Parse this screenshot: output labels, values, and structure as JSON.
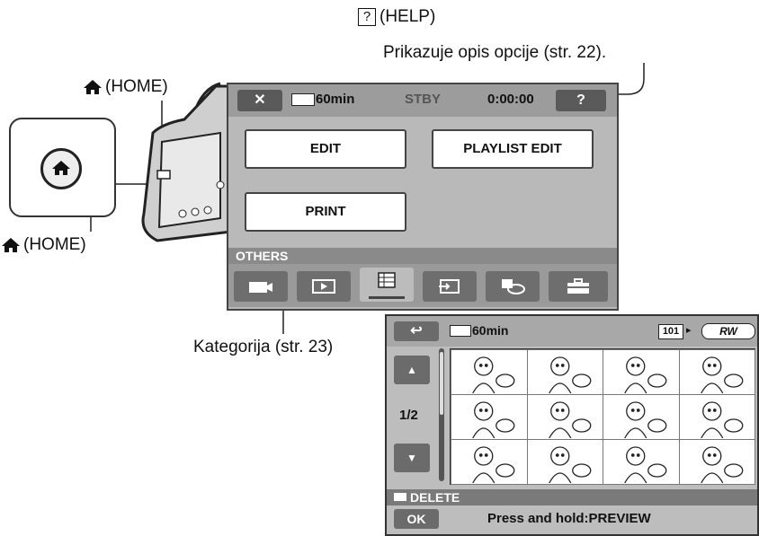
{
  "help_callout": {
    "box_glyph": "?",
    "label": "(HELP)",
    "description": "Prikazuje opis opcije (str. 22)."
  },
  "home_top_label": "(HOME)",
  "home_bottom_label": "(HOME)",
  "category_callout": "Kategorija (str. 23)",
  "screen1": {
    "close_glyph": "✕",
    "battery": "60min",
    "status": "STBY",
    "timecode": "0:00:00",
    "help_glyph": "?",
    "menu": {
      "edit": "EDIT",
      "playlist_edit": "PLAYLIST EDIT",
      "print": "PRINT"
    },
    "category_name": "OTHERS",
    "category_icons": [
      "camera-icon",
      "play-icon",
      "others-list-icon",
      "import-icon",
      "disc-icon",
      "toolbox-icon"
    ]
  },
  "screen2": {
    "back_glyph": "↩",
    "battery": "60min",
    "folder": "101",
    "media": "RW",
    "page": "1/2",
    "delete_label": "DELETE",
    "ok_label": "OK",
    "hint": "Press and hold:PREVIEW",
    "thumb_icons": [
      "boy-with-dog-icon",
      "girl-with-birds-icon",
      "dog-icon",
      "boy-icon",
      "mother-with-baby-icon",
      "standing-child-icon",
      "boy-waving-icon",
      "flower-icon",
      "boy-s-shirt-icon",
      "dog-face-icon",
      "birds-and-dog-icon",
      "dog-icon"
    ]
  }
}
